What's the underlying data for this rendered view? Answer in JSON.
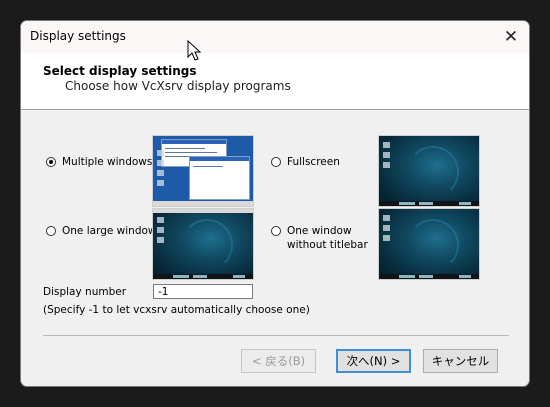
{
  "window": {
    "title": "Display settings",
    "close_glyph": "✕"
  },
  "header": {
    "title": "Select display settings",
    "subtitle": "Choose how VcXsrv display programs"
  },
  "options": [
    {
      "label": "Multiple windows",
      "selected": true
    },
    {
      "label": "Fullscreen",
      "selected": false
    },
    {
      "label": "One large window",
      "selected": false
    },
    {
      "label": "One window\nwithout titlebar",
      "selected": false
    }
  ],
  "display_number": {
    "label": "Display number",
    "value": "-1",
    "hint": "(Specify -1 to let vcxsrv automatically choose one)"
  },
  "buttons": {
    "back": "< 戻る(B)",
    "next": "次へ(N) >",
    "cancel": "キャンセル"
  },
  "icons": {
    "close": "close-icon",
    "cursor": "mouse-pointer-icon"
  },
  "colors": {
    "default_button_border": "#3c8fd8",
    "desktop_teal": "#114a62"
  }
}
